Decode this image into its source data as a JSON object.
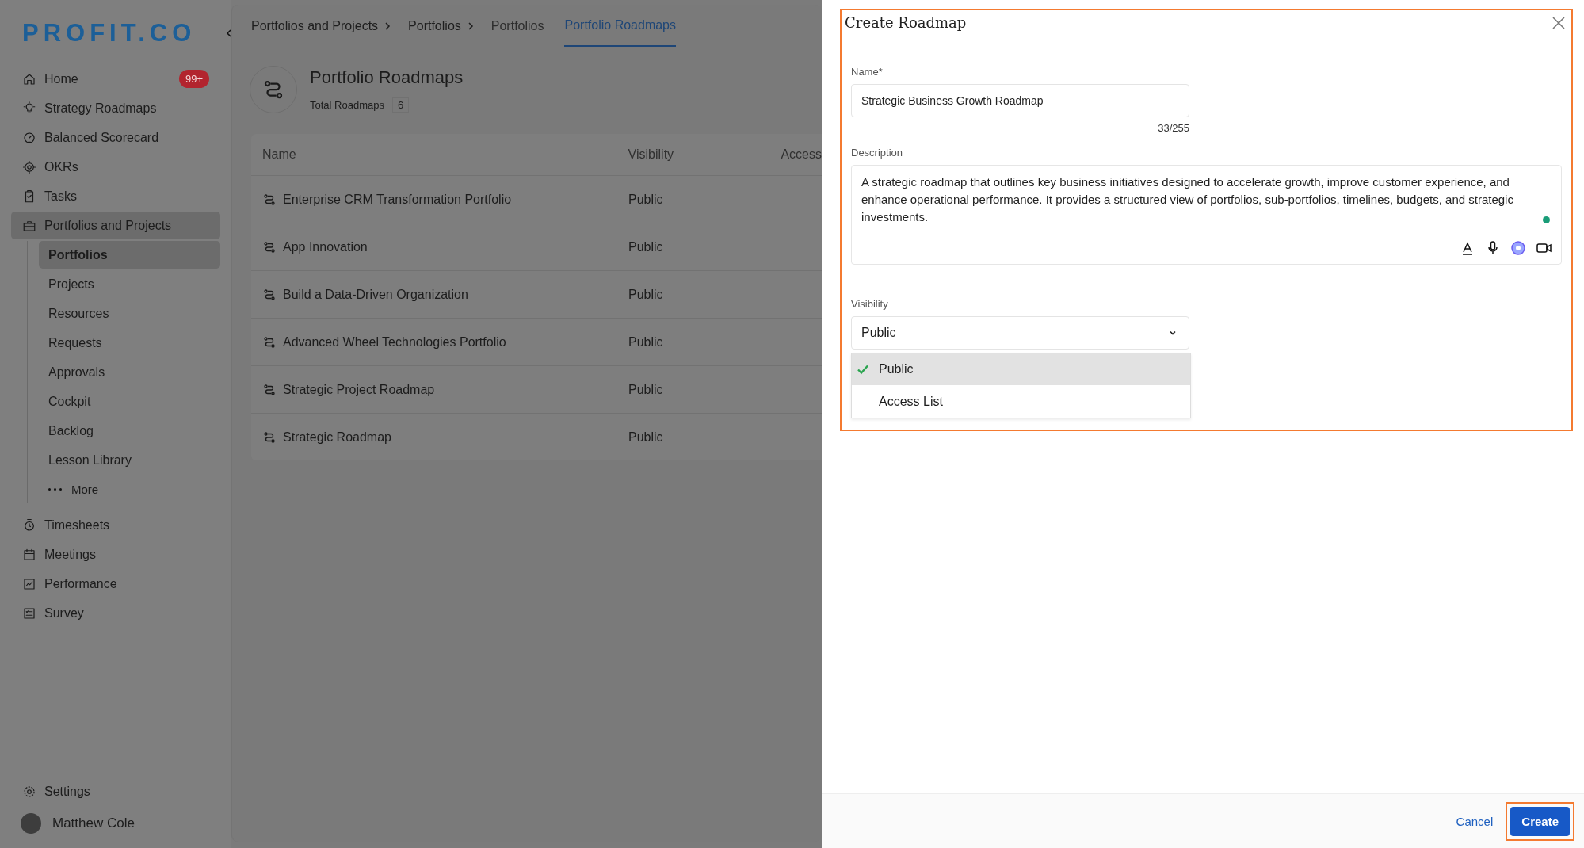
{
  "logo": {
    "text": "PROFIT.CO"
  },
  "sidebar": {
    "items": [
      {
        "label": "Home",
        "selected": false,
        "badge": "99+"
      },
      {
        "label": "Strategy Roadmaps",
        "selected": false
      },
      {
        "label": "Balanced Scorecard",
        "selected": false
      },
      {
        "label": "OKRs",
        "selected": false
      },
      {
        "label": "Tasks",
        "selected": false
      },
      {
        "label": "Portfolios and Projects",
        "selected": true,
        "children": [
          {
            "label": "Portfolios",
            "selected": true
          },
          {
            "label": "Projects",
            "selected": false
          },
          {
            "label": "Resources",
            "selected": false
          },
          {
            "label": "Requests",
            "selected": false
          },
          {
            "label": "Approvals",
            "selected": false
          },
          {
            "label": "Cockpit",
            "selected": false
          },
          {
            "label": "Backlog",
            "selected": false
          },
          {
            "label": "Lesson Library",
            "selected": false
          },
          {
            "label": "More",
            "selected": false,
            "kind": "more"
          }
        ]
      },
      {
        "label": "Timesheets",
        "selected": false
      },
      {
        "label": "Meetings",
        "selected": false
      },
      {
        "label": "Performance",
        "selected": false
      },
      {
        "label": "Survey",
        "selected": false
      }
    ],
    "settings": "Settings",
    "user": "Matthew Cole"
  },
  "breadcrumbs": [
    "Portfolios and Projects",
    "Portfolios"
  ],
  "tabs": [
    {
      "label": "Portfolios",
      "selected": false
    },
    {
      "label": "Portfolio Roadmaps",
      "selected": true
    }
  ],
  "page": {
    "title": "Portfolio Roadmaps",
    "total_label": "Total Roadmaps",
    "total": "6"
  },
  "table": {
    "columns": [
      "Name",
      "Visibility",
      "Access"
    ],
    "rows": [
      {
        "name": "Enterprise CRM Transformation Portfolio",
        "visibility": "Public"
      },
      {
        "name": "App Innovation",
        "visibility": "Public"
      },
      {
        "name": "Build a Data-Driven Organization",
        "visibility": "Public"
      },
      {
        "name": "Advanced Wheel Technologies Portfolio",
        "visibility": "Public"
      },
      {
        "name": "Strategic Project Roadmap",
        "visibility": "Public"
      },
      {
        "name": "Strategic Roadmap",
        "visibility": "Public"
      }
    ]
  },
  "dialog": {
    "title": "Create Roadmap",
    "name_label": "Name*",
    "name_value": "Strategic Business Growth Roadmap",
    "counter": "33/255",
    "description_label": "Description",
    "description_value": "A strategic roadmap that outlines key business initiatives designed to accelerate growth, improve customer experience, and enhance operational performance. It provides a structured view of portfolios, sub-portfolios, timelines, budgets, and strategic investments.",
    "visibility_label": "Visibility",
    "visibility_value": "Public",
    "options": [
      {
        "label": "Public",
        "selected": true
      },
      {
        "label": "Access List",
        "selected": false
      }
    ],
    "cancel": "Cancel",
    "create": "Create"
  }
}
